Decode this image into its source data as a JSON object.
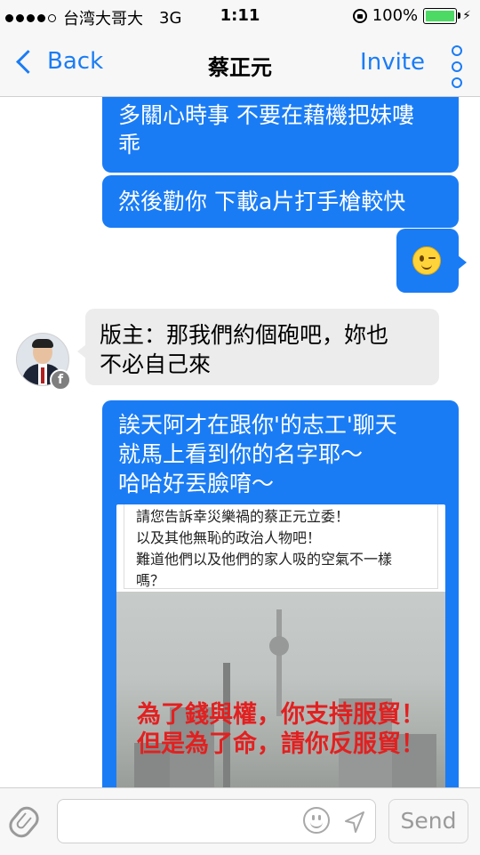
{
  "status_bar": {
    "carrier": "台湾大哥大",
    "network": "3G",
    "time": "1:11",
    "battery": "100%",
    "battery_level": 1.0
  },
  "nav": {
    "back_label": "Back",
    "title": "蔡正元",
    "invite_label": "Invite"
  },
  "messages": [
    {
      "direction": "sent",
      "lines": [
        "多關心時事 不要在藉機把妹嘍",
        "乖"
      ]
    },
    {
      "direction": "sent",
      "lines": [
        "然後勸你 下載a片打手槍較快"
      ]
    },
    {
      "direction": "sent",
      "emoji": "winking-face"
    },
    {
      "direction": "received",
      "lines": [
        "版主：那我們約個砲吧，妳也",
        "不必自己來"
      ]
    },
    {
      "direction": "sent",
      "lines": [
        "誒天阿才在跟你'的志工'聊天",
        "就馬上看到你的名字耶～",
        "哈哈好丟臉唷～"
      ],
      "attachment": {
        "text_lines": [
          "請您告訴幸災樂禍的蔡正元立委！",
          "以及其他無恥的政治人物吧！",
          "難道他們以及他們的家人吸的空氣不一樣",
          "嗎？"
        ],
        "slogan_lines": [
          "為了錢與權，你支持服貿！",
          "但是為了命，請你反服貿！"
        ]
      }
    }
  ],
  "input": {
    "placeholder": "",
    "send_label": "Send"
  },
  "colors": {
    "accent": "#1a7cf5",
    "received_bubble": "#ececec",
    "battery": "#4cd964",
    "slogan": "#e22020"
  }
}
